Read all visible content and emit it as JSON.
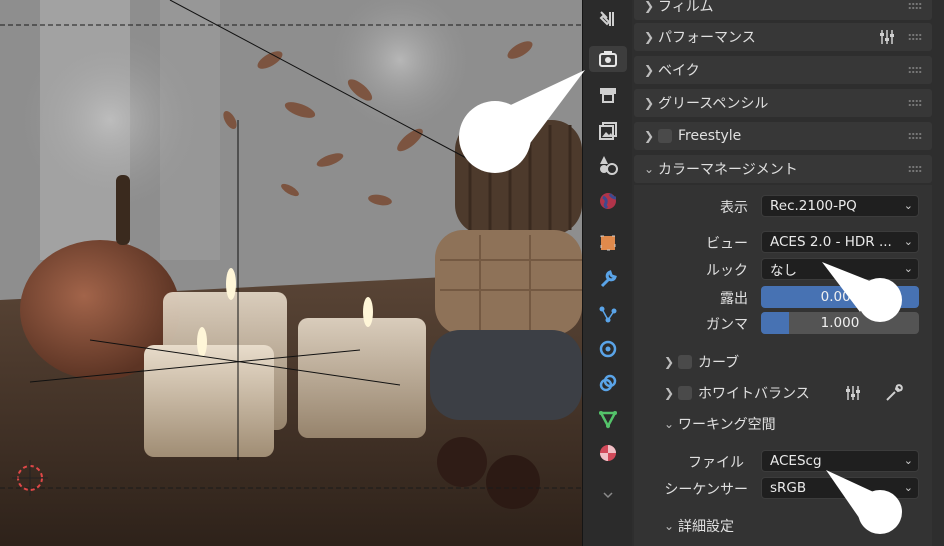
{
  "properties": {
    "panels": [
      {
        "label": "フィルム",
        "icon": "chevron-right-icon"
      },
      {
        "label": "パフォーマンス",
        "icon": "chevron-right-icon",
        "extra_icon": "sliders-icon"
      },
      {
        "label": "ベイク",
        "icon": "chevron-right-icon"
      },
      {
        "label": "グリースペンシル",
        "icon": "chevron-right-icon"
      },
      {
        "label": "Freestyle",
        "icon": "chevron-right-icon",
        "checkbox": true
      },
      {
        "label": "カラーマネージメント",
        "icon": "chevron-down-icon"
      }
    ],
    "color_management": {
      "display_label": "表示",
      "display_value": "Rec.2100-PQ",
      "view_label": "ビュー",
      "view_value": "ACES 2.0 - HDR ...",
      "look_label": "ルック",
      "look_value": "なし",
      "exposure_label": "露出",
      "exposure_value": "0.000",
      "gamma_label": "ガンマ",
      "gamma_value": "1.000",
      "gamma_fill": 0.18
    },
    "curves_label": "カーブ",
    "white_balance_label": "ホワイトバランス",
    "working_space": {
      "label": "ワーキング空間",
      "file_label": "ファイル",
      "file_value": "ACEScg",
      "sequencer_label": "シーケンサー",
      "sequencer_value": "sRGB"
    },
    "advanced_label": "詳細設定"
  },
  "colors": {
    "accent": "#4772b3",
    "panel_bg": "#2e2e2e",
    "header_bg": "#373737"
  }
}
